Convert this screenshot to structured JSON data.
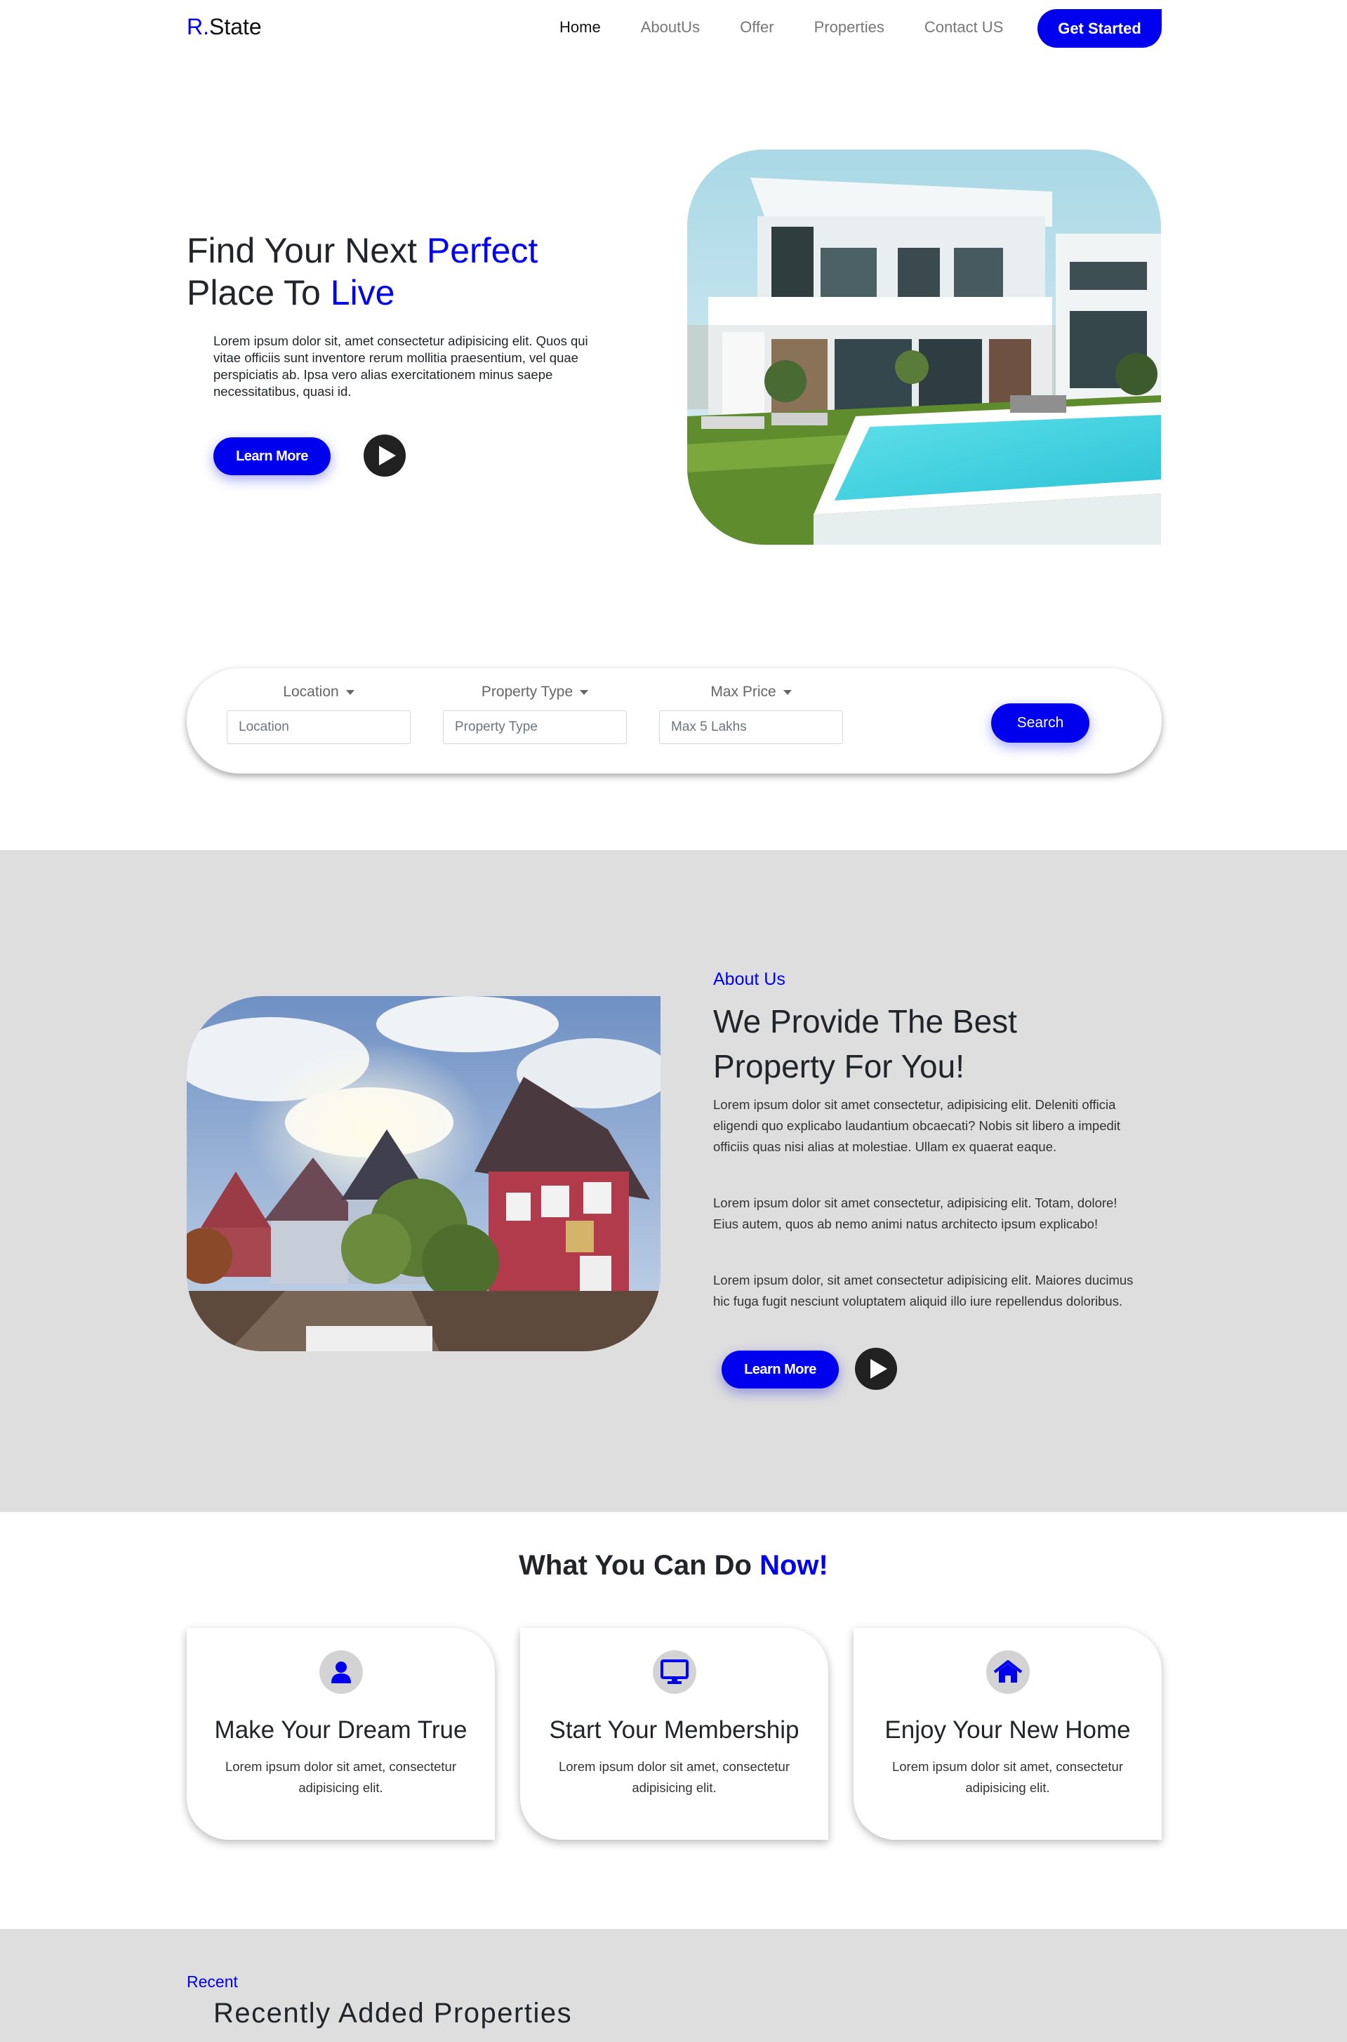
{
  "brand": {
    "prefix": "R.",
    "name": "State"
  },
  "nav": {
    "items": [
      {
        "label": "Home"
      },
      {
        "label": "AboutUs"
      },
      {
        "label": "Offer"
      },
      {
        "label": "Properties"
      },
      {
        "label": "Contact US"
      }
    ],
    "cta_label": "Get Started"
  },
  "hero": {
    "title_part1": "Find Your Next ",
    "title_highlight1": "Perfect",
    "title_part2": "Place To ",
    "title_highlight2": "Live",
    "text": "Lorem ipsum dolor sit, amet consectetur adipisicing elit. Quos qui vitae officiis sunt inventore rerum mollitia praesentium, vel quae perspiciatis ab. Ipsa vero alias exercitationem minus saepe necessitatibus, quasi id.",
    "learn_more_label": "Learn More"
  },
  "search": {
    "location_label": "Location",
    "location_placeholder": "Location",
    "type_label": "Property Type",
    "type_placeholder": "Property Type",
    "price_label": "Max Price",
    "price_placeholder": "Max 5 Lakhs",
    "button_label": "Search"
  },
  "about": {
    "kicker": "About Us",
    "title": "We Provide The Best Property For You!",
    "paragraphs": [
      "Lorem ipsum dolor sit amet consectetur, adipisicing elit. Deleniti officia eligendi quo explicabo laudantium obcaecati? Nobis sit libero a impedit officiis quas nisi alias at molestiae. Ullam ex quaerat eaque.",
      "Lorem ipsum dolor sit amet consectetur, adipisicing elit. Totam, dolore! Eius autem, quos ab nemo animi natus architecto ipsum explicabo!",
      "Lorem ipsum dolor, sit amet consectetur adipisicing elit. Maiores ducimus hic fuga fugit nesciunt voluptatem aliquid illo iure repellendus doloribus."
    ],
    "learn_more_label": "Learn More"
  },
  "services": {
    "title_part": "What You Can Do ",
    "title_highlight": "Now!",
    "cards": [
      {
        "icon": "user-icon",
        "title": "Make Your Dream True",
        "text": "Lorem ipsum dolor sit amet, consectetur adipisicing elit."
      },
      {
        "icon": "desktop-icon",
        "title": "Start Your Membership",
        "text": "Lorem ipsum dolor sit amet, consectetur adipisicing elit."
      },
      {
        "icon": "home-icon",
        "title": "Enjoy Your New Home",
        "text": "Lorem ipsum dolor sit amet, consectetur adipisicing elit."
      }
    ]
  },
  "recent": {
    "kicker": "Recent",
    "title": "Recently Added Properties"
  },
  "colors": {
    "accent": "#0000ee",
    "section_gray": "#dedede",
    "dark": "#212529"
  }
}
